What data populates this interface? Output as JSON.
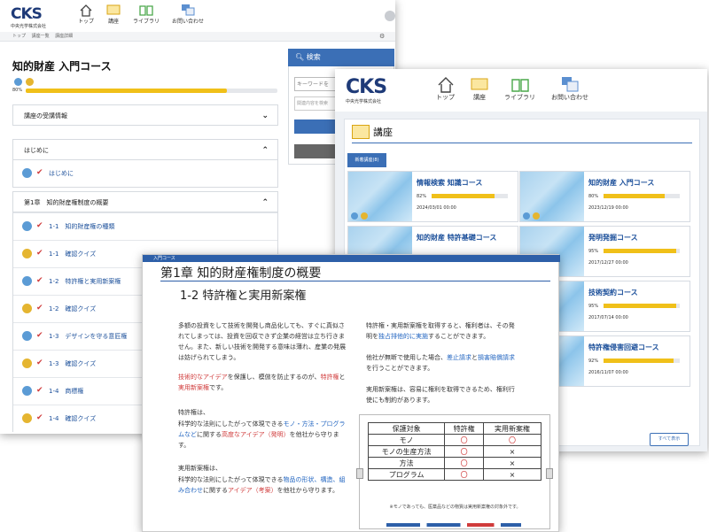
{
  "brand": {
    "logo": "CKS",
    "sub": "中央光学株式会社"
  },
  "nav": {
    "top": "トップ",
    "course": "講座",
    "library": "ライブラリ",
    "contact": "お問い合わせ"
  },
  "winA": {
    "breadcrumb": "トップ　 講座一覧　 講座詳細",
    "title": "知的財産 入門コース",
    "progress_label": "80%",
    "progress": 0.8,
    "acc_info": "講座の受講情報",
    "acc_intro": "はじめに",
    "intro_item": "はじめに",
    "acc_ch1": "第1章　知的財産権制度の概要",
    "items": [
      {
        "label": "1-1　知的財産権の種類",
        "kind": "video"
      },
      {
        "label": "1-1　確認クイズ",
        "kind": "quiz"
      },
      {
        "label": "1-2　特許権と実用新案権",
        "kind": "video"
      },
      {
        "label": "1-2　確認クイズ",
        "kind": "quiz"
      },
      {
        "label": "1-3　デザインを守る意匠権",
        "kind": "video"
      },
      {
        "label": "1-3　確認クイズ",
        "kind": "quiz"
      },
      {
        "label": "1-4　商標権",
        "kind": "video"
      },
      {
        "label": "1-4　確認クイズ",
        "kind": "quiz"
      }
    ],
    "search_title": "検索",
    "search_placeholder": "キーワードを",
    "select_placeholder": "関連内容を検索"
  },
  "winB": {
    "heading": "講座",
    "tab": "新着講座(8)",
    "cards": [
      {
        "title": "情報検索 知識コース",
        "pct": "82%",
        "value": 0.82,
        "date": "2024/03/01 00:00"
      },
      {
        "title": "知的財産 入門コース",
        "pct": "80%",
        "value": 0.8,
        "date": "2023/12/19 00:00"
      },
      {
        "title": "知的財産 特許基礎コース",
        "pct": "",
        "value": 0,
        "date": ""
      },
      {
        "title": "発明発掘コース",
        "pct": "95%",
        "value": 0.95,
        "date": "2017/12/27 00:00"
      },
      {
        "title": "",
        "pct": "",
        "value": 0,
        "date": ""
      },
      {
        "title": "技術契約コース",
        "pct": "95%",
        "value": 0.95,
        "date": "2017/07/14 00:00"
      },
      {
        "title": "",
        "pct": "",
        "value": 0,
        "date": ""
      },
      {
        "title": "特許権侵害回避コース",
        "pct": "92%",
        "value": 0.92,
        "date": "2016/11/07 00:00"
      }
    ],
    "all_button": "すべて表示"
  },
  "winC": {
    "tag": "入門コース",
    "chapter": "第1章 知的財産権制度の概要",
    "section": "1-2 特許権と実用新案権",
    "left_p1": "多額の投資をして技術を開発し商品化しても、すぐに真似されてしまっては、投資を回収できず企業の経営は立ち行きません。また、新しい技術を開発する意味は薄れ、産業の発展は妨げられてしまう。",
    "left_p2a": "技術的なアイデア",
    "left_p2b": "を保護し、模倣を防止するのが、",
    "left_p2c": "特許権",
    "left_p2d": "と",
    "left_p2e": "実用新案権",
    "left_p2f": "です。",
    "left_p3": "特許権は、",
    "left_p4a": "科学的な法則にしたがって体現できる",
    "left_p4b": "モノ・方法・プログラムなど",
    "left_p4c": "に関する",
    "left_p4d": "高度なアイデア（発明）",
    "left_p4e": "を他社から守ります。",
    "left_p5": "実用新案権は、",
    "left_p6a": "科学的な法則にしたがって体現できる",
    "left_p6b": "物品の形状、構造、組み合わせ",
    "left_p6c": "に関する",
    "left_p6d": "アイデア（考案）",
    "left_p6e": "を他社から守ります。",
    "right_p1a": "特許権・実用新案権を取得すると、権利者は、その発明を",
    "right_p1b": "独占排他的に実施",
    "right_p1c": "することができます。",
    "right_p2a": "他社が無断で使用した場合、",
    "right_p2b": "差止請求",
    "right_p2c": "と",
    "right_p2d": "損害賠償請求",
    "right_p2e": "を行うことができます。",
    "right_p3": "実用新案権は、容易に権利を取得できるため、権利行使にも制約があります。",
    "table": {
      "headers": [
        "保護対象",
        "特許権",
        "実用新案権"
      ],
      "rows": [
        [
          "モノ",
          "〇",
          "〇"
        ],
        [
          "モノの生産方法",
          "〇",
          "×"
        ],
        [
          "方法",
          "〇",
          "×"
        ],
        [
          "プログラム",
          "〇",
          "×"
        ]
      ]
    },
    "note": "※モノであっても、医薬品などの物質は実用新案権の対象外です。"
  }
}
